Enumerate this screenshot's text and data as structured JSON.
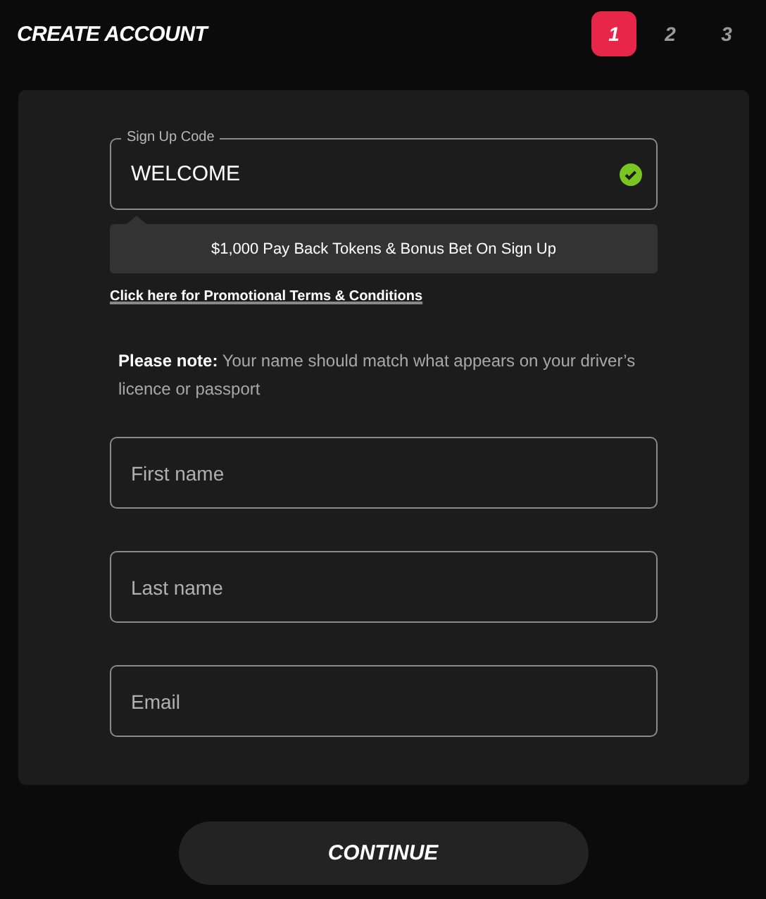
{
  "header": {
    "title": "CREATE ACCOUNT"
  },
  "steps": [
    {
      "label": "1",
      "selected": true
    },
    {
      "label": "2",
      "selected": false
    },
    {
      "label": "3",
      "selected": false
    }
  ],
  "signup_code": {
    "label": "Sign Up Code",
    "value": "WELCOME",
    "valid": true
  },
  "promo": {
    "text": "$1,000 Pay Back Tokens & Bonus Bet On Sign Up",
    "link": "Click here for Promotional Terms & Conditions"
  },
  "note": "**Please note:** Your name should match what appears on your driver’s licence or passport",
  "fields": [
    {
      "placeholder": "First name"
    },
    {
      "placeholder": "Last name"
    },
    {
      "placeholder": "Email"
    }
  ],
  "continue_button": "CONTINUE"
}
